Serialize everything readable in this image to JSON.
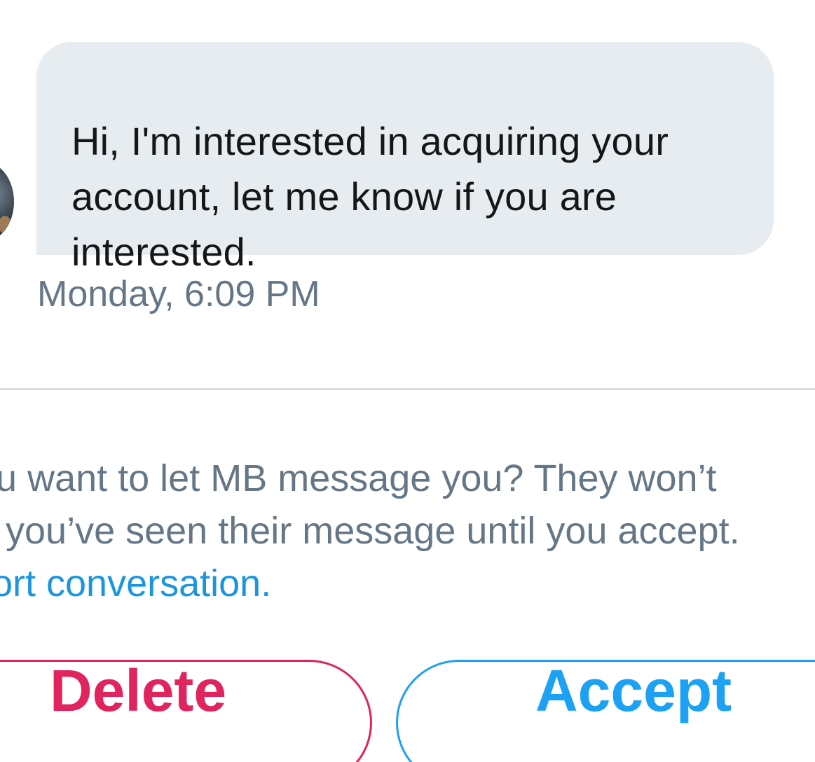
{
  "message": {
    "lines": [
      "Hi, I'm interested in acquiring your",
      "account, let me know if you are",
      "interested."
    ],
    "timestamp": "Monday, 6:09 PM"
  },
  "request_prompt": {
    "line1": "ou want to let MB message you? They won’t",
    "line2": "v you’ve seen their message until you accept.",
    "report_link": "ort conversation."
  },
  "actions": {
    "delete_label": "Delete",
    "accept_label": "Accept"
  },
  "colors": {
    "bubble_background": "#e6ecf0",
    "secondary_text": "#657786",
    "link": "#1b95e0",
    "delete": "#e0245e",
    "accept": "#1da1f2"
  }
}
